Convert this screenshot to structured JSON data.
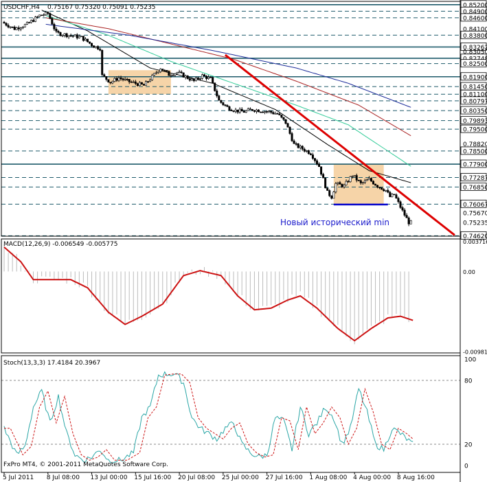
{
  "header": {
    "symbol": "USDCHF,H4",
    "quote": "0.75167 0.75320 0.75091 0.75235"
  },
  "macd_header": "MACD(12,26,9) -0.006549 -0.005775",
  "stoch_header": "Stoch(13,3,3) 17.4184 20.3967",
  "copyright": "FxPro MT4, © 2001-2011 MetaQuotes Software Corp.",
  "annotation": "Новый исторический min",
  "colors": {
    "candle": "#000000",
    "trendline": "#dd0000",
    "support": "#0000cc",
    "zone": "#f6d4a8",
    "ma_black": "#000000",
    "ma_green": "#33cc99",
    "ma_red": "#aa2222",
    "ma_blue": "#1a2a99",
    "level_line": "#1d5a6a",
    "macd_hist": "#bbbbbb",
    "macd_signal": "#cc1111",
    "stoch_main": "#2aa6a6",
    "stoch_signal": "#cc1111",
    "annotation": "#1a1acc"
  },
  "chart_data": [
    {
      "type": "candlestick",
      "panel": "price",
      "y_ticks": [
        "0.85200",
        "0.84900",
        "0.84600",
        "0.84100",
        "0.83800",
        "0.83262",
        "0.83050",
        "0.82748",
        "0.82500",
        "0.81900",
        "0.81450",
        "0.81100",
        "0.80797",
        "0.80350",
        "0.79893",
        "0.79500",
        "0.78820",
        "0.78500",
        "0.77900",
        "0.77287",
        "0.76850",
        "0.76067",
        "0.75670",
        "0.75235",
        "0.74620"
      ],
      "ylim": [
        0.746,
        0.8535
      ],
      "dashed_levels": [
        0.852,
        0.849,
        0.846,
        0.838,
        0.83262,
        0.82748,
        0.825,
        0.819,
        0.8145,
        0.811,
        0.80797,
        0.8035,
        0.79893,
        0.795,
        0.785,
        0.779,
        0.77287,
        0.7685,
        0.76067,
        0.7462
      ],
      "solid_levels": [
        0.852,
        0.83262,
        0.82748,
        0.819,
        0.779
      ],
      "x_ticks": [
        "5 Jul 2011",
        "8 Jul 08:00",
        "13 Jul 00:00",
        "15 Jul 16:00",
        "20 Jul 08:00",
        "25 Jul 00:00",
        "27 Jul 16:00",
        "1 Aug 08:00",
        "4 Aug 00:00",
        "8 Aug 16:00"
      ],
      "path": [
        [
          0,
          0.844
        ],
        [
          6,
          0.841
        ],
        [
          12,
          0.843
        ],
        [
          18,
          0.847
        ],
        [
          22,
          0.848
        ],
        [
          26,
          0.839
        ],
        [
          32,
          0.838
        ],
        [
          38,
          0.837
        ],
        [
          44,
          0.833
        ],
        [
          47,
          0.832
        ],
        [
          48,
          0.8195
        ],
        [
          52,
          0.8165
        ],
        [
          56,
          0.8185
        ],
        [
          60,
          0.817
        ],
        [
          64,
          0.816
        ],
        [
          68,
          0.815
        ],
        [
          72,
          0.819
        ],
        [
          76,
          0.823
        ],
        [
          80,
          0.82
        ],
        [
          84,
          0.821
        ],
        [
          88,
          0.819
        ],
        [
          92,
          0.817
        ],
        [
          96,
          0.8195
        ],
        [
          100,
          0.818
        ],
        [
          104,
          0.808
        ],
        [
          108,
          0.805
        ],
        [
          112,
          0.8035
        ],
        [
          116,
          0.803
        ],
        [
          120,
          0.804
        ],
        [
          124,
          0.8035
        ],
        [
          128,
          0.803
        ],
        [
          132,
          0.802
        ],
        [
          136,
          0.798
        ],
        [
          140,
          0.788
        ],
        [
          144,
          0.786
        ],
        [
          148,
          0.784
        ],
        [
          152,
          0.778
        ],
        [
          156,
          0.766
        ],
        [
          158,
          0.764
        ],
        [
          160,
          0.77
        ],
        [
          164,
          0.769
        ],
        [
          168,
          0.774
        ],
        [
          172,
          0.77
        ],
        [
          176,
          0.772
        ],
        [
          180,
          0.769
        ],
        [
          184,
          0.767
        ],
        [
          186,
          0.764
        ],
        [
          188,
          0.765
        ],
        [
          192,
          0.7575
        ],
        [
          195,
          0.7523
        ]
      ],
      "n_bars": 196,
      "moving_averages": [
        {
          "color": "ma_black",
          "points": [
            [
              18,
              0.8495
            ],
            [
              40,
              0.84
            ],
            [
              70,
              0.823
            ],
            [
              100,
              0.816
            ],
            [
              130,
              0.804
            ],
            [
              155,
              0.788
            ],
            [
              175,
              0.776
            ],
            [
              195,
              0.7705
            ]
          ]
        },
        {
          "color": "ma_green",
          "points": [
            [
              20,
              0.847
            ],
            [
              50,
              0.838
            ],
            [
              80,
              0.826
            ],
            [
              110,
              0.816
            ],
            [
              140,
              0.806
            ],
            [
              165,
              0.797
            ],
            [
              195,
              0.778
            ]
          ]
        },
        {
          "color": "ma_red",
          "points": [
            [
              20,
              0.846
            ],
            [
              50,
              0.841
            ],
            [
              80,
              0.834
            ],
            [
              110,
              0.827
            ],
            [
              140,
              0.817
            ],
            [
              170,
              0.806
            ],
            [
              195,
              0.792
            ]
          ]
        },
        {
          "color": "ma_blue",
          "points": [
            [
              20,
              0.843
            ],
            [
              60,
              0.838
            ],
            [
              100,
              0.831
            ],
            [
              140,
              0.823
            ],
            [
              165,
              0.816
            ],
            [
              195,
              0.805
            ]
          ]
        }
      ],
      "trendline": {
        "from": [
          106,
          0.829
        ],
        "to": [
          216,
          0.7465
        ]
      },
      "support_line": {
        "from": [
          158,
          0.7605
        ],
        "to": [
          184,
          0.7605
        ]
      },
      "zones": [
        {
          "from": [
            50,
            0.822
          ],
          "to": [
            80,
            0.811
          ]
        },
        {
          "from": [
            158,
            0.779
          ],
          "to": [
            182,
            0.7605
          ]
        }
      ]
    },
    {
      "type": "line",
      "panel": "macd",
      "y_ticks": [
        "0.003716",
        "0.00",
        "-0.009819"
      ],
      "ylim": [
        -0.01,
        0.004
      ],
      "series_points": [
        [
          0,
          0.003
        ],
        [
          8,
          0.0012
        ],
        [
          14,
          -0.001
        ],
        [
          24,
          -0.001
        ],
        [
          32,
          -0.001
        ],
        [
          40,
          -0.002
        ],
        [
          50,
          -0.005
        ],
        [
          58,
          -0.0065
        ],
        [
          66,
          -0.0055
        ],
        [
          76,
          -0.004
        ],
        [
          86,
          -0.0005
        ],
        [
          94,
          0.0001
        ],
        [
          104,
          -0.0005
        ],
        [
          112,
          -0.003
        ],
        [
          120,
          -0.0047
        ],
        [
          128,
          -0.0045
        ],
        [
          136,
          -0.0035
        ],
        [
          142,
          -0.003
        ],
        [
          150,
          -0.0045
        ],
        [
          160,
          -0.007
        ],
        [
          168,
          -0.0085
        ],
        [
          176,
          -0.007
        ],
        [
          184,
          -0.0057
        ],
        [
          190,
          -0.0055
        ],
        [
          196,
          -0.006
        ]
      ],
      "histogram": true
    },
    {
      "type": "line",
      "panel": "stochastic",
      "y_ticks": [
        "100",
        "80",
        "20",
        "0"
      ],
      "ylim": [
        0,
        100
      ],
      "series_points": [
        [
          0,
          35
        ],
        [
          6,
          10
        ],
        [
          10,
          18
        ],
        [
          14,
          55
        ],
        [
          18,
          70
        ],
        [
          22,
          40
        ],
        [
          26,
          65
        ],
        [
          30,
          30
        ],
        [
          34,
          10
        ],
        [
          38,
          5
        ],
        [
          42,
          8
        ],
        [
          46,
          15
        ],
        [
          50,
          5
        ],
        [
          56,
          5
        ],
        [
          62,
          12
        ],
        [
          66,
          45
        ],
        [
          70,
          55
        ],
        [
          74,
          85
        ],
        [
          78,
          86
        ],
        [
          82,
          86
        ],
        [
          86,
          78
        ],
        [
          90,
          45
        ],
        [
          94,
          35
        ],
        [
          98,
          30
        ],
        [
          102,
          25
        ],
        [
          106,
          35
        ],
        [
          110,
          40
        ],
        [
          114,
          20
        ],
        [
          118,
          12
        ],
        [
          122,
          8
        ],
        [
          126,
          10
        ],
        [
          130,
          45
        ],
        [
          134,
          42
        ],
        [
          138,
          15
        ],
        [
          142,
          55
        ],
        [
          146,
          30
        ],
        [
          150,
          40
        ],
        [
          154,
          55
        ],
        [
          158,
          45
        ],
        [
          162,
          20
        ],
        [
          166,
          35
        ],
        [
          170,
          72
        ],
        [
          174,
          50
        ],
        [
          178,
          20
        ],
        [
          182,
          15
        ],
        [
          186,
          35
        ],
        [
          190,
          30
        ],
        [
          196,
          20
        ]
      ],
      "levels": [
        80,
        20
      ]
    }
  ]
}
